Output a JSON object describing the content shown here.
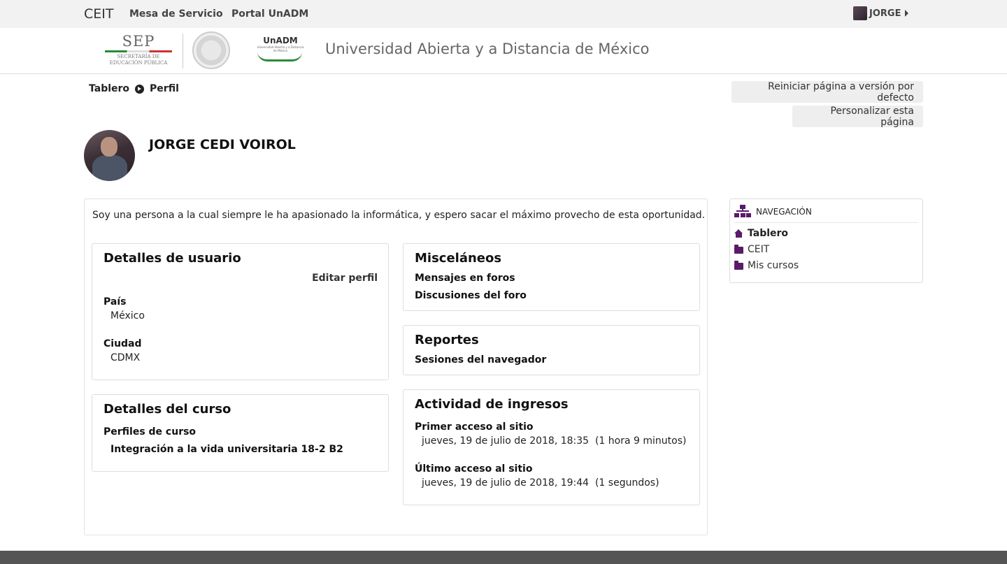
{
  "topbar": {
    "brand": "CEIT",
    "links": [
      "Mesa de Servicio",
      "Portal UnADM"
    ],
    "user_label": "JORGE"
  },
  "header": {
    "sep_logo": "SEP",
    "sep_sub1": "SECRETARÍA DE",
    "sep_sub2": "EDUCACIÓN PÚBLICA",
    "unadm_logo": "UnADM",
    "unadm_sub": "Universidad Abierta y a Distancia de México",
    "site_title": "Universidad Abierta y a Distancia de México"
  },
  "breadcrumb": [
    "Tablero",
    "Perfil"
  ],
  "buttons": {
    "reset": "Reiniciar página a versión por defecto",
    "customize": "Personalizar esta página"
  },
  "profile": {
    "name": "JORGE CEDI VOIROL",
    "bio": "Soy una persona a la cual siempre le ha apasionado la informática, y espero sacar el máximo provecho de esta oportunidad."
  },
  "user_details": {
    "title": "Detalles de usuario",
    "edit": "Editar perfil",
    "country_label": "País",
    "country": "México",
    "city_label": "Ciudad",
    "city": "CDMX"
  },
  "course_details": {
    "title": "Detalles del curso",
    "profiles_label": "Perfiles de curso",
    "course": "Integración a la vida universitaria 18-2 B2"
  },
  "misc": {
    "title": "Misceláneos",
    "forum_posts": "Mensajes en foros",
    "forum_discussions": "Discusiones del foro"
  },
  "reports": {
    "title": "Reportes",
    "sessions": "Sesiones del navegador"
  },
  "activity": {
    "title": "Actividad de ingresos",
    "first_label": "Primer acceso al sitio",
    "first_value": "jueves, 19 de julio de 2018, 18:35  (1 hora 9 minutos)",
    "last_label": "Último acceso al sitio",
    "last_value": "jueves, 19 de julio de 2018, 19:44  (1 segundos)"
  },
  "navigation": {
    "title": "NAVEGACIÓN",
    "items": [
      "Tablero",
      "CEIT",
      "Mis cursos"
    ]
  },
  "colors": {
    "accent": "#5a1a6a",
    "topbar": "#f2f2f2",
    "footer": "#555555"
  }
}
